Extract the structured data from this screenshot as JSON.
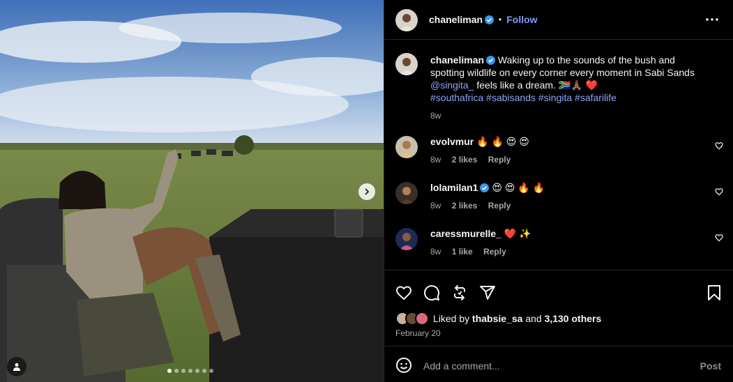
{
  "post": {
    "author": "chaneliman",
    "separator": "•",
    "follow_label": "Follow",
    "caption_lines": [
      "Waking up to the sounds of the bush and",
      "spotting wildlife on every corner every moment in Sabi Sands"
    ],
    "caption_mention": "@singita_",
    "caption_tail": "feels like a dream. 🇿🇦🙏🏾 ❤️",
    "hashtags": [
      "#southafrica",
      "#sabisands",
      "#singita",
      "#safarilife"
    ],
    "caption_time": "8w"
  },
  "comments": [
    {
      "user": "evolvmur",
      "text": "🔥 🔥 😍 😍",
      "time": "8w",
      "likes": "2 likes",
      "reply": "Reply"
    },
    {
      "user": "lolamilan1",
      "text": "😍 😍 🔥 🔥",
      "time": "8w",
      "likes": "2 likes",
      "reply": "Reply",
      "verified": true
    },
    {
      "user": "caressmurelle_",
      "text": "❤️ ✨",
      "time": "8w",
      "likes": "1 like",
      "reply": "Reply"
    }
  ],
  "likes": {
    "prefix": "Liked by",
    "user": "thabsie_sa",
    "middle": "and",
    "others": "3,130 others"
  },
  "date": "February 20",
  "add_comment": {
    "placeholder": "Add a comment...",
    "post_label": "Post"
  },
  "carousel": {
    "count": 7,
    "active_index": 0
  },
  "colors": {
    "link": "#8ea4f8",
    "follow": "#7f9cf5",
    "verified": "#3897f0",
    "background": "#000000"
  },
  "icons": [
    "verified-icon",
    "more-icon",
    "heart-icon",
    "comment-icon",
    "repost-icon",
    "share-icon",
    "save-icon",
    "emoji-icon",
    "chevron-right-icon",
    "user-tag-icon"
  ]
}
